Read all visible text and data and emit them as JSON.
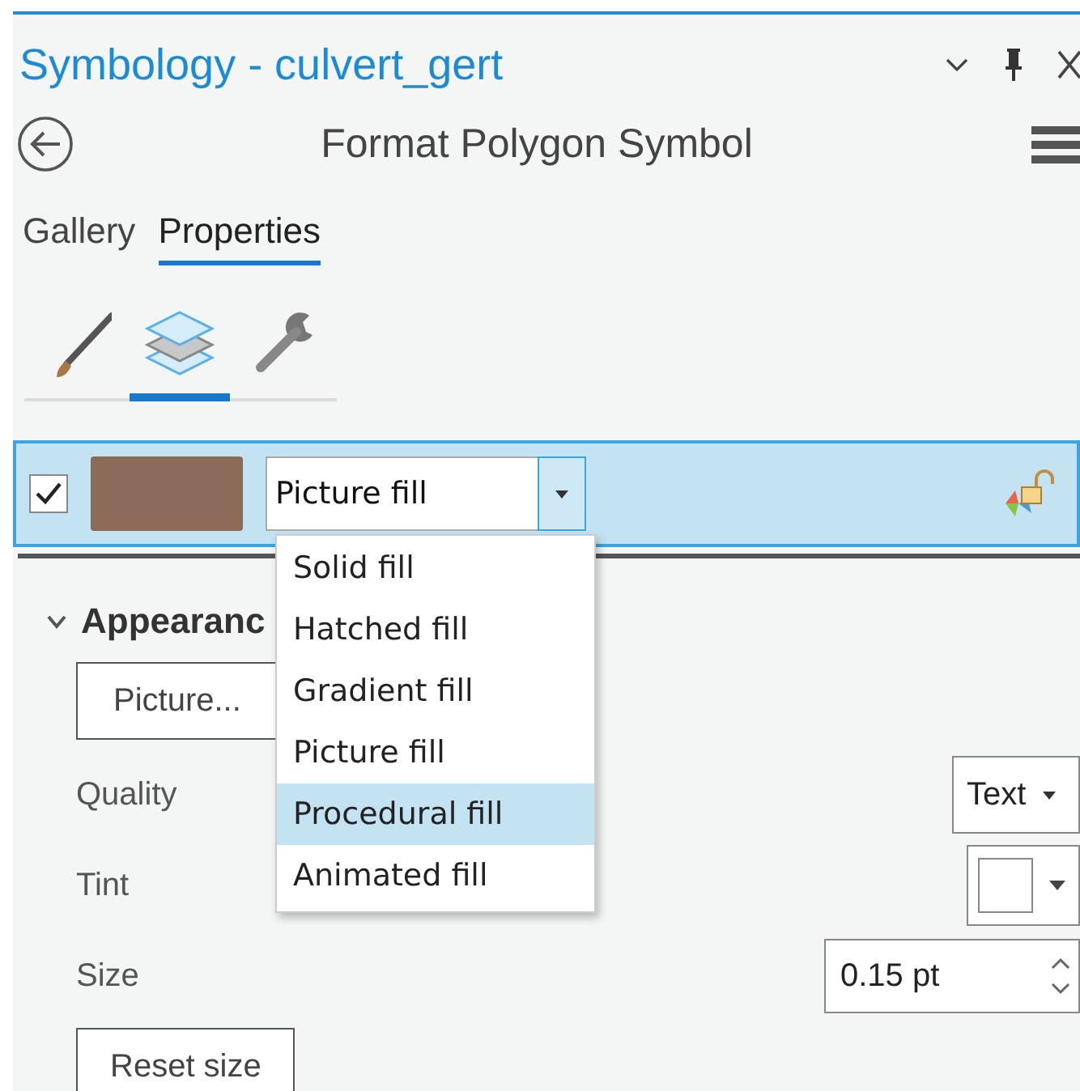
{
  "pane": {
    "title": "Symbology - culvert_gert",
    "subtitle": "Format Polygon Symbol"
  },
  "tabs": [
    {
      "label": "Gallery",
      "selected": false
    },
    {
      "label": "Properties",
      "selected": true
    }
  ],
  "tool_tabs": [
    {
      "kind": "brush",
      "selected": false
    },
    {
      "kind": "layers",
      "selected": true
    },
    {
      "kind": "wrench",
      "selected": false
    }
  ],
  "layer": {
    "checked": true,
    "selected": true,
    "fill_type": "Picture fill"
  },
  "fill_menu": [
    {
      "label": "Solid fill",
      "selected": false
    },
    {
      "label": "Hatched fill",
      "selected": false
    },
    {
      "label": "Gradient fill",
      "selected": false
    },
    {
      "label": "Picture fill",
      "selected": false
    },
    {
      "label": "Procedural fill",
      "selected": true
    },
    {
      "label": "Animated fill",
      "selected": false
    }
  ],
  "section": {
    "label": "Appearanc",
    "expanded": true
  },
  "picture_button": "Picture...",
  "properties": [
    {
      "kind": "combo",
      "label": "Quality",
      "value": "Text"
    },
    {
      "kind": "color",
      "label": "Tint"
    },
    {
      "kind": "spinner",
      "label": "Size",
      "value": "0.15 pt"
    }
  ],
  "reset_button": "Reset size"
}
